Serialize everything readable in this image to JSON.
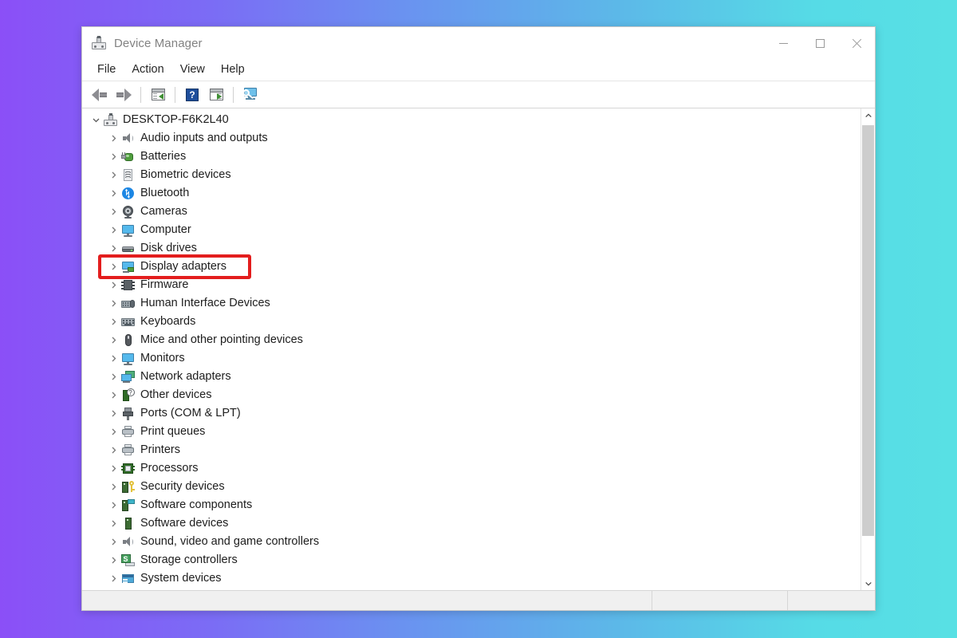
{
  "window": {
    "title": "Device Manager",
    "title_icon": "device-manager-icon",
    "controls": {
      "minimize": "minimize-button",
      "maximize": "maximize-button",
      "close": "close-button"
    }
  },
  "menu": {
    "items": [
      {
        "label": "File"
      },
      {
        "label": "Action"
      },
      {
        "label": "View"
      },
      {
        "label": "Help"
      }
    ]
  },
  "toolbar": {
    "buttons": [
      {
        "name": "back-button",
        "icon": "back-arrow-icon"
      },
      {
        "name": "forward-button",
        "icon": "forward-arrow-icon"
      },
      {
        "name": "properties-button",
        "icon": "properties-icon"
      },
      {
        "name": "help-button",
        "icon": "help-icon",
        "glyph": "?"
      },
      {
        "name": "update-driver-button",
        "icon": "update-driver-icon"
      },
      {
        "name": "scan-hardware-button",
        "icon": "scan-for-hardware-changes-icon"
      }
    ]
  },
  "tree": {
    "root": {
      "label": "DESKTOP-F6K2L40",
      "icon": "computer-icon",
      "expanded": true,
      "chevron": "chevron-down-icon"
    },
    "items": [
      {
        "label": "Audio inputs and outputs",
        "icon": "speaker-icon"
      },
      {
        "label": "Batteries",
        "icon": "battery-icon"
      },
      {
        "label": "Biometric devices",
        "icon": "fingerprint-icon"
      },
      {
        "label": "Bluetooth",
        "icon": "bluetooth-icon"
      },
      {
        "label": "Cameras",
        "icon": "camera-icon"
      },
      {
        "label": "Computer",
        "icon": "monitor-icon"
      },
      {
        "label": "Disk drives",
        "icon": "disk-drive-icon"
      },
      {
        "label": "Display adapters",
        "icon": "display-adapter-icon",
        "highlighted": true
      },
      {
        "label": "Firmware",
        "icon": "firmware-chip-icon"
      },
      {
        "label": "Human Interface Devices",
        "icon": "hid-icon"
      },
      {
        "label": "Keyboards",
        "icon": "keyboard-icon"
      },
      {
        "label": "Mice and other pointing devices",
        "icon": "mouse-icon"
      },
      {
        "label": "Monitors",
        "icon": "monitor-icon"
      },
      {
        "label": "Network adapters",
        "icon": "network-adapter-icon"
      },
      {
        "label": "Other devices",
        "icon": "unknown-device-icon"
      },
      {
        "label": "Ports (COM & LPT)",
        "icon": "port-icon"
      },
      {
        "label": "Print queues",
        "icon": "printer-icon"
      },
      {
        "label": "Printers",
        "icon": "printer-icon"
      },
      {
        "label": "Processors",
        "icon": "processor-icon"
      },
      {
        "label": "Security devices",
        "icon": "security-key-icon"
      },
      {
        "label": "Software components",
        "icon": "software-component-icon"
      },
      {
        "label": "Software devices",
        "icon": "software-device-icon"
      },
      {
        "label": "Sound, video and game controllers",
        "icon": "speaker-icon"
      },
      {
        "label": "Storage controllers",
        "icon": "storage-controller-icon"
      },
      {
        "label": "System devices",
        "icon": "system-device-icon"
      }
    ],
    "child_chevron": "chevron-right-icon"
  },
  "scrollbar": {
    "up_arrow": "scroll-up-arrow-icon",
    "down_arrow": "scroll-down-arrow-icon"
  },
  "statusbar": {
    "main": "",
    "pane2": "",
    "pane3": ""
  },
  "colors": {
    "highlight_box": "#e31d1d",
    "background_gradient_start": "#8b4ff7",
    "background_gradient_end": "#58e0e4",
    "title_text": "#828282"
  }
}
